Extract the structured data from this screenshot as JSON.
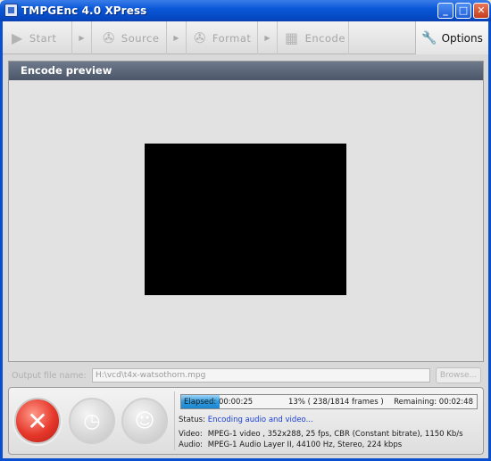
{
  "window": {
    "title": "TMPGEnc 4.0 XPress"
  },
  "toolbar": {
    "steps": [
      {
        "label": "Start",
        "icon": "play-icon"
      },
      {
        "label": "Source",
        "icon": "film-reel-icon"
      },
      {
        "label": "Format",
        "icon": "film-reel-icon"
      },
      {
        "label": "Encode",
        "icon": "film-strip-icon"
      }
    ],
    "options_label": "Options"
  },
  "preview": {
    "title": "Encode preview"
  },
  "output": {
    "label": "Output file name:",
    "value": "H:\\vcd\\t4x-watsothorn.mpg",
    "browse_label": "Browse..."
  },
  "progress": {
    "fraction": 0.13,
    "elapsed": "Elapsed: 00:00:25",
    "middle": "13% ( 238/1814  frames )",
    "remaining": "Remaining: 00:02:48"
  },
  "info": {
    "status_label": "Status:",
    "status_value": "Encoding audio and video...",
    "video_label": "Video:",
    "video_value": "MPEG-1 video , 352x288, 25 fps, CBR (Constant bitrate), 1150 Kb/s",
    "audio_label": "Audio:",
    "audio_value": "MPEG-1 Audio Layer II, 44100 Hz, Stereo, 224 kbps"
  },
  "colors": {
    "accent": "#2e9ae0",
    "cancel": "#e5372a",
    "titlebar": "#0548c2",
    "status": "#1a3fd6"
  }
}
